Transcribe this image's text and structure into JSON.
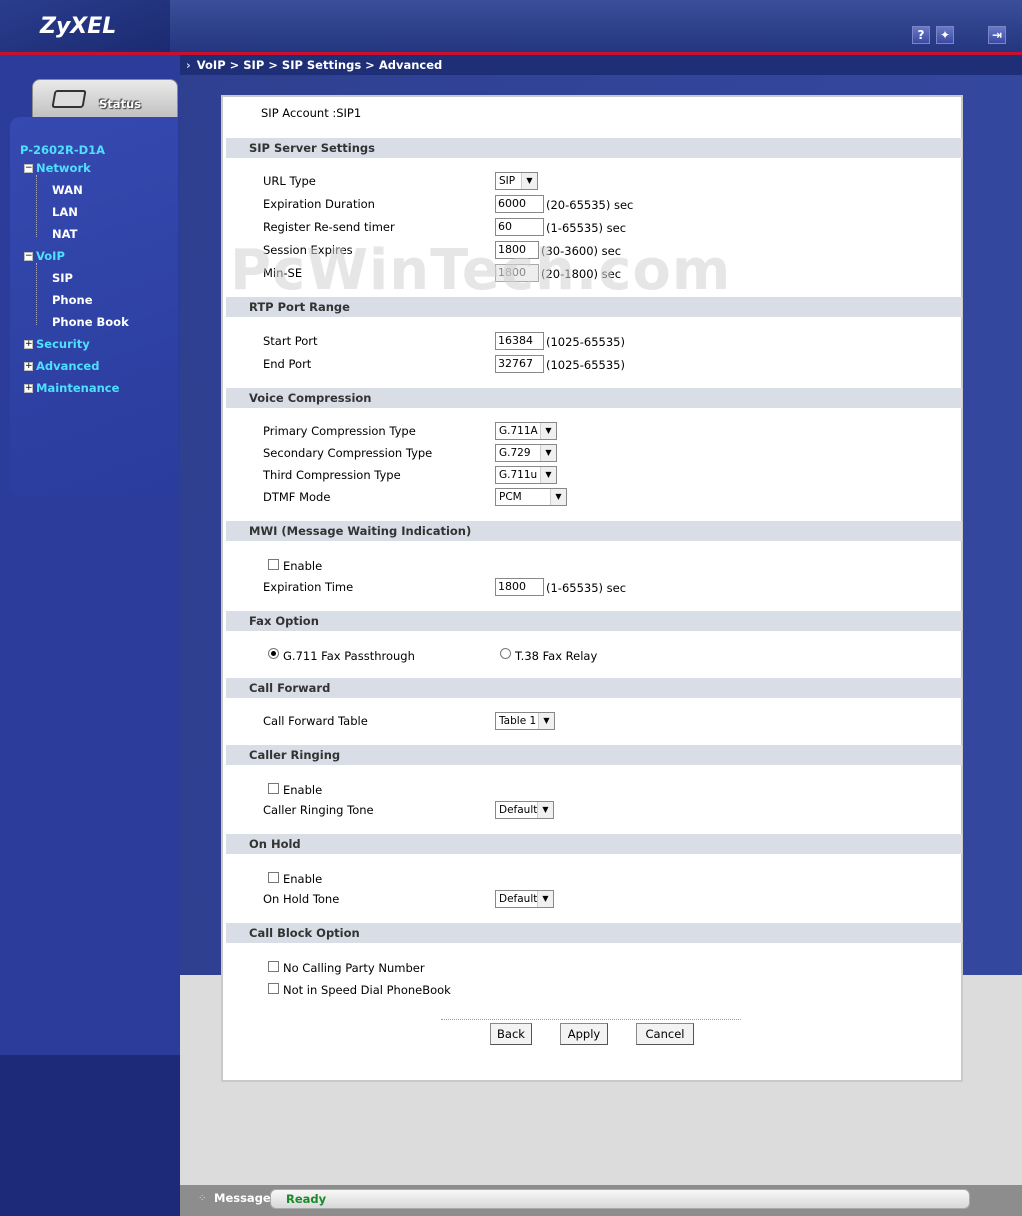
{
  "header": {
    "logo": "ZyXEL",
    "breadcrumb": "VoIP > SIP > SIP Settings > Advanced",
    "icons": [
      "help-icon",
      "wizard-icon",
      "logout-icon"
    ]
  },
  "sidebar": {
    "status_tab": "Status",
    "model": "P-2602R-D1A",
    "items": [
      {
        "label": "Network"
      },
      {
        "label": "WAN"
      },
      {
        "label": "LAN"
      },
      {
        "label": "NAT"
      },
      {
        "label": "VoIP"
      },
      {
        "label": "SIP"
      },
      {
        "label": "Phone"
      },
      {
        "label": "Phone Book"
      },
      {
        "label": "Security"
      },
      {
        "label": "Advanced"
      },
      {
        "label": "Maintenance"
      }
    ]
  },
  "watermark": "PcWinTech.com",
  "account": "SIP Account :SIP1",
  "sections": {
    "sip_server": {
      "title": "SIP Server Settings",
      "url_type_label": "URL Type",
      "url_type_value": "SIP",
      "expiration_label": "Expiration Duration",
      "expiration_value": "6000",
      "expiration_unit": "(20-65535) sec",
      "resend_label": "Register Re-send timer",
      "resend_value": "60",
      "resend_unit": "(1-65535) sec",
      "session_label": "Session Expires",
      "session_value": "1800",
      "session_unit": "(30-3600) sec",
      "minse_label": "Min-SE",
      "minse_value": "1800",
      "minse_unit": "(20-1800) sec"
    },
    "rtp": {
      "title": "RTP Port Range",
      "start_label": "Start Port",
      "start_value": "16384",
      "start_unit": "(1025-65535)",
      "end_label": "End Port",
      "end_value": "32767",
      "end_unit": "(1025-65535)"
    },
    "voice": {
      "title": "Voice Compression",
      "primary_label": "Primary Compression Type",
      "primary_value": "G.711A",
      "secondary_label": "Secondary Compression Type",
      "secondary_value": "G.729",
      "third_label": "Third Compression Type",
      "third_value": "G.711u",
      "dtmf_label": "DTMF Mode",
      "dtmf_value": "PCM"
    },
    "mwi": {
      "title": "MWI (Message Waiting Indication)",
      "enable_label": "Enable",
      "exp_label": "Expiration Time",
      "exp_value": "1800",
      "exp_unit": "(1-65535) sec"
    },
    "fax": {
      "title": "Fax Option",
      "opt1": "G.711 Fax Passthrough",
      "opt2": "T.38 Fax Relay"
    },
    "call_forward": {
      "title": "Call Forward",
      "table_label": "Call Forward Table",
      "table_value": "Table 1"
    },
    "caller_ringing": {
      "title": "Caller Ringing",
      "enable_label": "Enable",
      "tone_label": "Caller Ringing Tone",
      "tone_value": "Default"
    },
    "on_hold": {
      "title": "On Hold",
      "enable_label": "Enable",
      "tone_label": "On Hold Tone",
      "tone_value": "Default"
    },
    "call_block": {
      "title": "Call Block Option",
      "opt1": "No Calling Party Number",
      "opt2": "Not in Speed Dial PhoneBook"
    }
  },
  "buttons": {
    "back": "Back",
    "apply": "Apply",
    "cancel": "Cancel"
  },
  "message_bar": {
    "label": "Message",
    "status": "Ready"
  }
}
